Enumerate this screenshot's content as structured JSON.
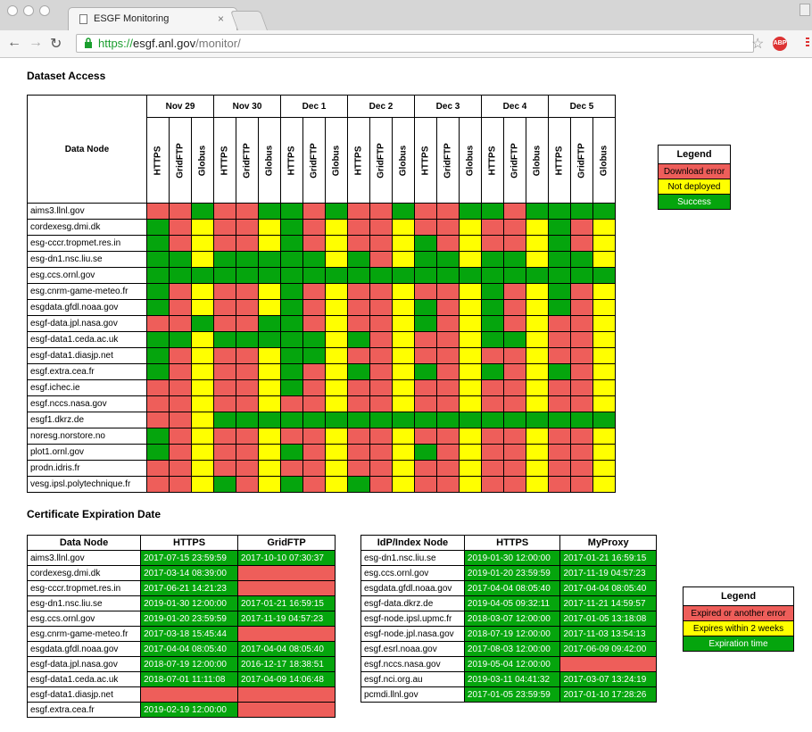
{
  "browser": {
    "tab_title": "ESGF Monitoring",
    "tab_close": "×",
    "url_scheme": "https://",
    "url_host": "esgf.anl.gov",
    "url_path": "/monitor/",
    "abp": "ABP"
  },
  "access": {
    "title": "Dataset Access",
    "node_header": "Data Node",
    "dates": [
      "Nov 29",
      "Nov 30",
      "Dec 1",
      "Dec 2",
      "Dec 3",
      "Dec 4",
      "Dec 5"
    ],
    "services": [
      "HTTPS",
      "GridFTP",
      "Globus"
    ],
    "rows": [
      {
        "name": "aims3.llnl.gov",
        "cells": "rrgrrggrgrrgrrggrgggg"
      },
      {
        "name": "cordexesg.dmi.dk",
        "cells": "gryrrygryrryrryrrygry"
      },
      {
        "name": "esg-cccr.tropmet.res.in",
        "cells": "gryrrygryrrygryrrygry"
      },
      {
        "name": "esg-dn1.nsc.liu.se",
        "cells": "ggygggggygryggyggyggy"
      },
      {
        "name": "esg.ccs.ornl.gov",
        "cells": "ggggggggggggggggggggg"
      },
      {
        "name": "esg.cnrm-game-meteo.fr",
        "cells": "gryrrygryrryrrygrygry"
      },
      {
        "name": "esgdata.gfdl.noaa.gov",
        "cells": "gryrrygryrrygrygrygry"
      },
      {
        "name": "esgf-data.jpl.nasa.gov",
        "cells": "rrgrrggryrrygrygryrry"
      },
      {
        "name": "esgf-data1.ceda.ac.uk",
        "cells": "ggygggggygryrryggyrry"
      },
      {
        "name": "esgf-data1.diasjp.net",
        "cells": "gryrryggyrryrryrryrry"
      },
      {
        "name": "esgf.extra.cea.fr",
        "cells": "gryrrygrygrygrygrygry"
      },
      {
        "name": "esgf.ichec.ie",
        "cells": "rryrrygryrryrryrryrry"
      },
      {
        "name": "esgf.nccs.nasa.gov",
        "cells": "rryrryrryrryrryrryrry"
      },
      {
        "name": "esgf1.dkrz.de",
        "cells": "rrygggggggggggggggggg"
      },
      {
        "name": "noresg.norstore.no",
        "cells": "gryrryrryrryrryrryrry"
      },
      {
        "name": "plot1.ornl.gov",
        "cells": "gryrrygryrrygryrryrry"
      },
      {
        "name": "prodn.idris.fr",
        "cells": "rryrryrryrryrryrryrry"
      },
      {
        "name": "vesg.ipsl.polytechnique.fr",
        "cells": "rrygrygrygryrryrryrry"
      }
    ],
    "legend": {
      "title": "Legend",
      "items": [
        "Download error",
        "Not deployed",
        "Success"
      ]
    }
  },
  "cert": {
    "title": "Certificate Expiration Date",
    "data_headers": [
      "Data Node",
      "HTTPS",
      "GridFTP"
    ],
    "data_rows": [
      {
        "name": "aims3.llnl.gov",
        "https": "2017-07-15 23:59:59",
        "https_s": "g",
        "grid": "2017-10-10 07:30:37",
        "grid_s": "g"
      },
      {
        "name": "cordexesg.dmi.dk",
        "https": "2017-03-14 08:39:00",
        "https_s": "g",
        "grid": "",
        "grid_s": "r"
      },
      {
        "name": "esg-cccr.tropmet.res.in",
        "https": "2017-06-21 14:21:23",
        "https_s": "g",
        "grid": "",
        "grid_s": "r"
      },
      {
        "name": "esg-dn1.nsc.liu.se",
        "https": "2019-01-30 12:00:00",
        "https_s": "g",
        "grid": "2017-01-21 16:59:15",
        "grid_s": "g"
      },
      {
        "name": "esg.ccs.ornl.gov",
        "https": "2019-01-20 23:59:59",
        "https_s": "g",
        "grid": "2017-11-19 04:57:23",
        "grid_s": "g"
      },
      {
        "name": "esg.cnrm-game-meteo.fr",
        "https": "2017-03-18 15:45:44",
        "https_s": "g",
        "grid": "",
        "grid_s": "r"
      },
      {
        "name": "esgdata.gfdl.noaa.gov",
        "https": "2017-04-04 08:05:40",
        "https_s": "g",
        "grid": "2017-04-04 08:05:40",
        "grid_s": "g"
      },
      {
        "name": "esgf-data.jpl.nasa.gov",
        "https": "2018-07-19 12:00:00",
        "https_s": "g",
        "grid": "2016-12-17 18:38:51",
        "grid_s": "g"
      },
      {
        "name": "esgf-data1.ceda.ac.uk",
        "https": "2018-07-01 11:11:08",
        "https_s": "g",
        "grid": "2017-04-09 14:06:48",
        "grid_s": "g"
      },
      {
        "name": "esgf-data1.diasjp.net",
        "https": "",
        "https_s": "r",
        "grid": "",
        "grid_s": "r"
      },
      {
        "name": "esgf.extra.cea.fr",
        "https": "2019-02-19 12:00:00",
        "https_s": "g",
        "grid": "",
        "grid_s": "r"
      }
    ],
    "idp_headers": [
      "IdP/Index Node",
      "HTTPS",
      "MyProxy"
    ],
    "idp_rows": [
      {
        "name": "esg-dn1.nsc.liu.se",
        "https": "2019-01-30 12:00:00",
        "https_s": "g",
        "proxy": "2017-01-21 16:59:15",
        "proxy_s": "g"
      },
      {
        "name": "esg.ccs.ornl.gov",
        "https": "2019-01-20 23:59:59",
        "https_s": "g",
        "proxy": "2017-11-19 04:57:23",
        "proxy_s": "g"
      },
      {
        "name": "esgdata.gfdl.noaa.gov",
        "https": "2017-04-04 08:05:40",
        "https_s": "g",
        "proxy": "2017-04-04 08:05:40",
        "proxy_s": "g"
      },
      {
        "name": "esgf-data.dkrz.de",
        "https": "2019-04-05 09:32:11",
        "https_s": "g",
        "proxy": "2017-11-21 14:59:57",
        "proxy_s": "g"
      },
      {
        "name": "esgf-node.ipsl.upmc.fr",
        "https": "2018-03-07 12:00:00",
        "https_s": "g",
        "proxy": "2017-01-05 13:18:08",
        "proxy_s": "g"
      },
      {
        "name": "esgf-node.jpl.nasa.gov",
        "https": "2018-07-19 12:00:00",
        "https_s": "g",
        "proxy": "2017-11-03 13:54:13",
        "proxy_s": "g"
      },
      {
        "name": "esgf.esrl.noaa.gov",
        "https": "2017-08-03 12:00:00",
        "https_s": "g",
        "proxy": "2017-06-09 09:42:00",
        "proxy_s": "g"
      },
      {
        "name": "esgf.nccs.nasa.gov",
        "https": "2019-05-04 12:00:00",
        "https_s": "g",
        "proxy": "",
        "proxy_s": "r"
      },
      {
        "name": "esgf.nci.org.au",
        "https": "2019-03-11 04:41:32",
        "https_s": "g",
        "proxy": "2017-03-07 13:24:19",
        "proxy_s": "g"
      },
      {
        "name": "pcmdi.llnl.gov",
        "https": "2017-01-05 23:59:59",
        "https_s": "g",
        "proxy": "2017-01-10 17:28:26",
        "proxy_s": "g"
      }
    ],
    "legend": {
      "title": "Legend",
      "items": [
        "Expired or another error",
        "Expires within 2 weeks",
        "Expiration time"
      ]
    }
  },
  "colors": {
    "error": "#ee5e5a",
    "warning": "#ffff00",
    "success": "#05a50d"
  },
  "icons": [
    "document-icon",
    "back-arrow-icon",
    "forward-arrow-icon",
    "reload-icon",
    "lock-icon",
    "bookmark-star-icon",
    "adblock-icon",
    "menu-icon",
    "user-icon"
  ]
}
